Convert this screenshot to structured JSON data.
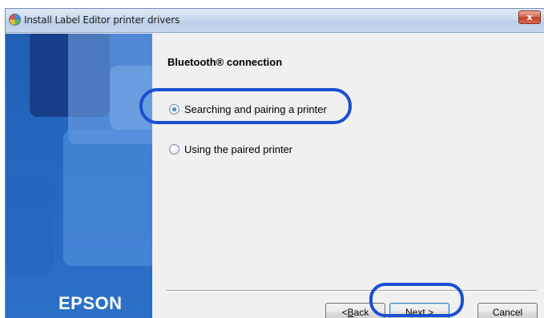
{
  "window": {
    "title": "Install Label Editor printer drivers",
    "close_glyph": "x"
  },
  "sidebar": {
    "brand": "EPSON"
  },
  "main": {
    "heading": "Bluetooth® connection",
    "options": [
      {
        "label": "Searching and pairing a printer",
        "selected": true
      },
      {
        "label": "Using the paired printer",
        "selected": false
      }
    ]
  },
  "footer": {
    "back_prefix": "< ",
    "back_accel": "B",
    "back_rest": "ack",
    "next_accel": "N",
    "next_rest": "ext >",
    "cancel_label": "Cancel"
  },
  "colors": {
    "highlight": "#1a4fd0",
    "sidebar": "#2468be"
  }
}
